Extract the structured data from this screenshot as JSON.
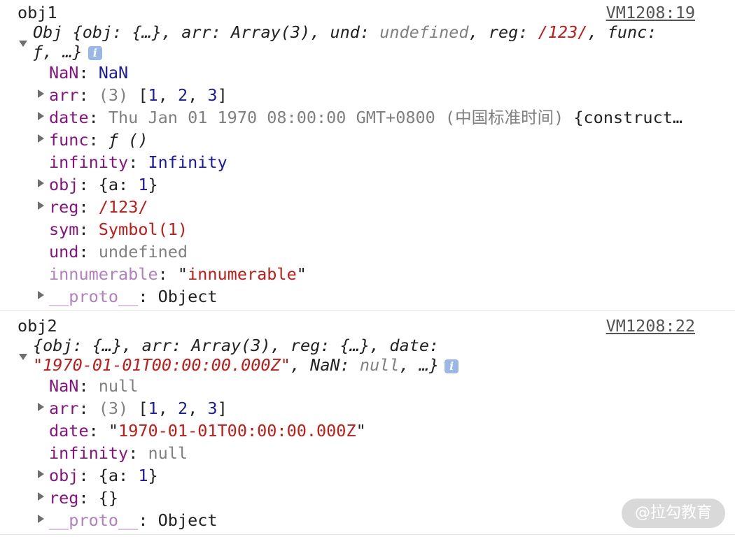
{
  "messages": [
    {
      "label": "obj1",
      "source": "VM1208:19",
      "preview_line1": {
        "open": "Obj {",
        "obj_key": "obj",
        "obj_val": "{…}",
        "arr_key": "arr",
        "arr_val": "Array(3)",
        "und_key": "und",
        "und_val": "undefined",
        "reg_key": "reg",
        "reg_val": "/123/",
        "func_key": "func"
      },
      "preview_line2": {
        "func_val": "ƒ",
        "tail": ", …}"
      },
      "info_icon": "i",
      "props": {
        "nan": {
          "key": "NaN",
          "value": "NaN"
        },
        "arr": {
          "key": "arr",
          "count": "(3)",
          "open": "[",
          "v1": "1",
          "v2": "2",
          "v3": "3",
          "close": "]"
        },
        "date": {
          "key": "date",
          "value": "Thu Jan 01 1970 08:00:00 GMT+0800 (中国标准时间)",
          "extra": "{construct…"
        },
        "func": {
          "key": "func",
          "value": "ƒ ()"
        },
        "infinity": {
          "key": "infinity",
          "value": "Infinity"
        },
        "obj": {
          "key": "obj",
          "open": "{a: ",
          "v": "1",
          "close": "}"
        },
        "reg": {
          "key": "reg",
          "value": "/123/"
        },
        "sym": {
          "key": "sym",
          "value": "Symbol(1)"
        },
        "und": {
          "key": "und",
          "value": "undefined"
        },
        "innum": {
          "key": "innumerable",
          "value": "innumerable"
        },
        "proto": {
          "key": "__proto__",
          "value": "Object"
        }
      }
    },
    {
      "label": "obj2",
      "source": "VM1208:22",
      "preview_line1": {
        "open": "{",
        "obj_key": "obj",
        "obj_val": "{…}",
        "arr_key": "arr",
        "arr_val": "Array(3)",
        "reg_key": "reg",
        "reg_val": "{…}",
        "date_key": "date"
      },
      "preview_line2": {
        "date_val": "1970-01-01T00:00:00.000Z",
        "nan_key": "NaN",
        "nan_val": "null",
        "tail": ", …}"
      },
      "info_icon": "i",
      "props": {
        "nan": {
          "key": "NaN",
          "value": "null"
        },
        "arr": {
          "key": "arr",
          "count": "(3)",
          "open": "[",
          "v1": "1",
          "v2": "2",
          "v3": "3",
          "close": "]"
        },
        "date": {
          "key": "date",
          "value": "1970-01-01T00:00:00.000Z"
        },
        "infinity": {
          "key": "infinity",
          "value": "null"
        },
        "obj": {
          "key": "obj",
          "open": "{a: ",
          "v": "1",
          "close": "}"
        },
        "reg": {
          "key": "reg",
          "value": "{}"
        },
        "proto": {
          "key": "__proto__",
          "value": "Object"
        }
      }
    }
  ],
  "watermark": "@拉勾教育",
  "colors": {
    "key": "#881280",
    "number": "#1a1aa6",
    "string": "#c41a16",
    "muted": "#808080",
    "info": "#9ab7e8"
  }
}
